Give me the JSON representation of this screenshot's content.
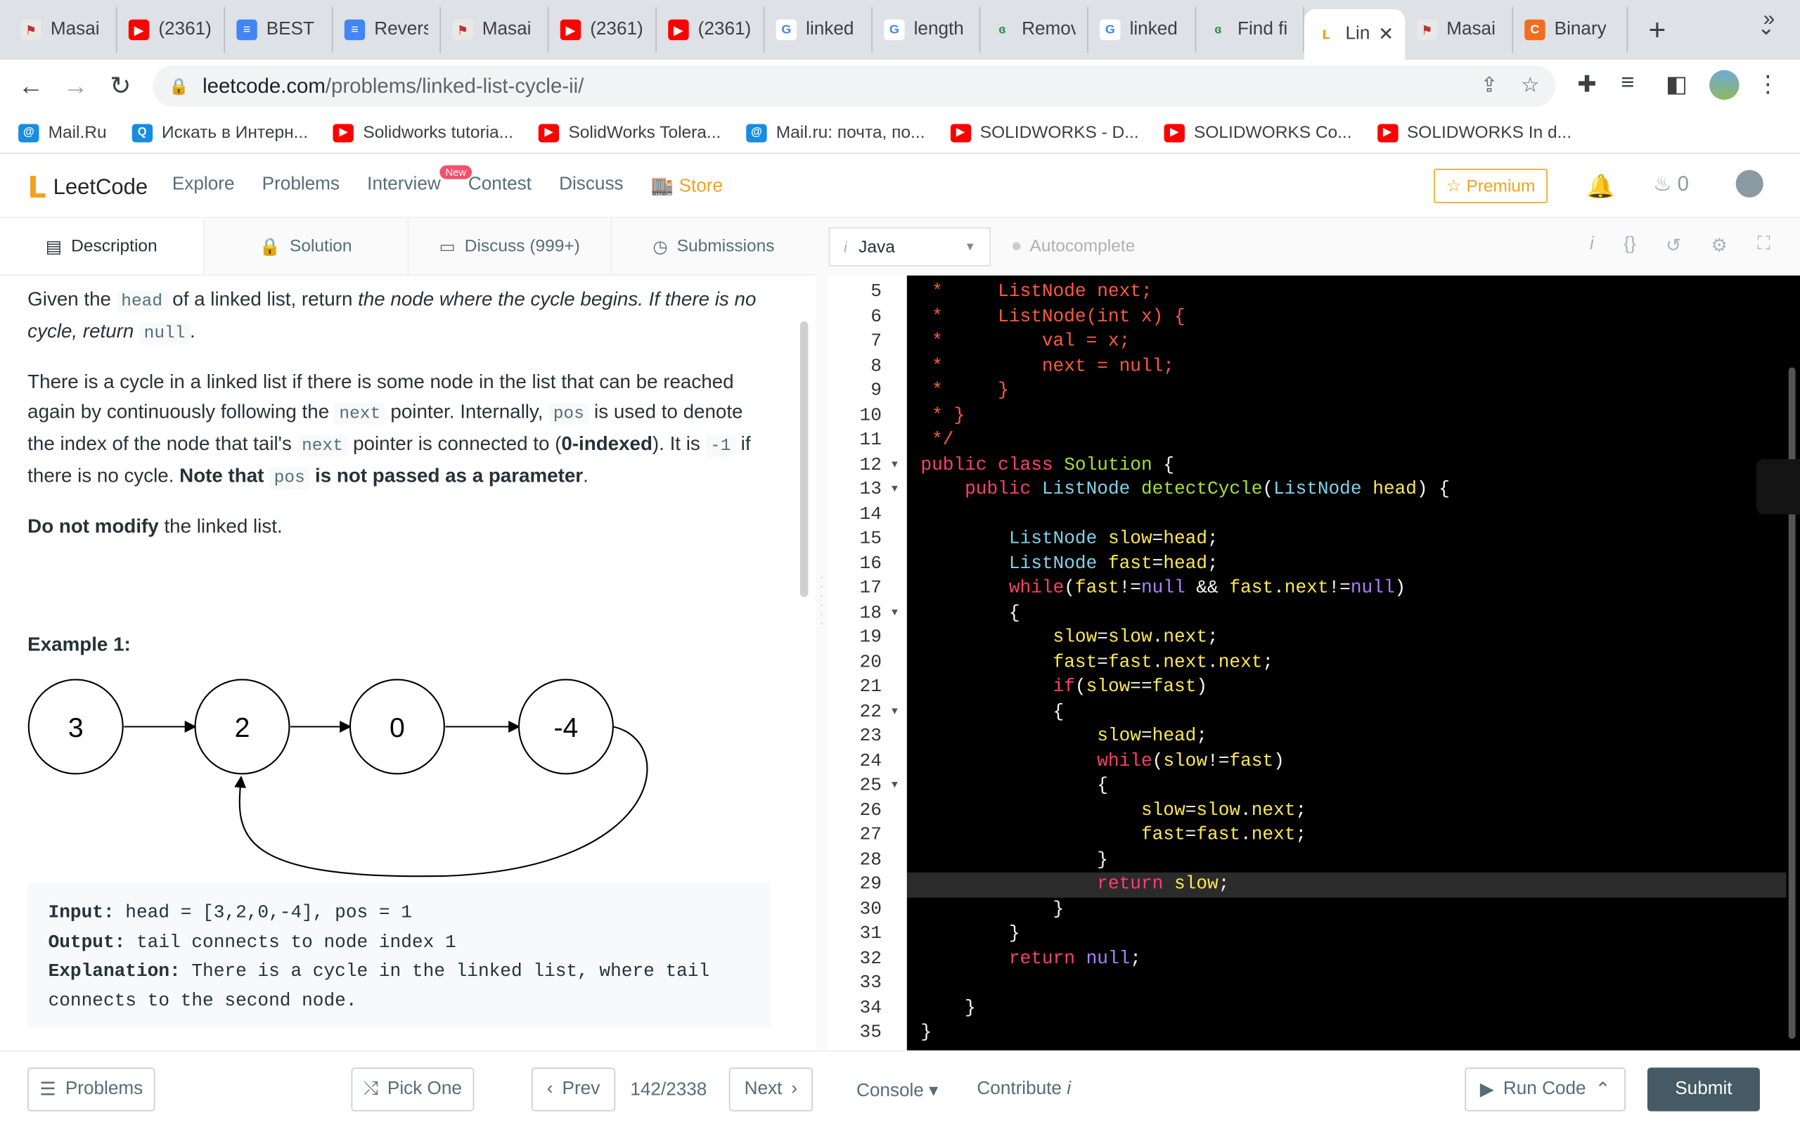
{
  "browser": {
    "tabs": [
      {
        "title": "Masai",
        "icon": "masai-icon",
        "color": "#e8e8e8"
      },
      {
        "title": "(2361)",
        "icon": "youtube-icon",
        "color": "#ff0000"
      },
      {
        "title": "BEST I",
        "icon": "docs-icon",
        "color": "#4285f4"
      },
      {
        "title": "Revers",
        "icon": "docs-icon",
        "color": "#4285f4"
      },
      {
        "title": "Masai",
        "icon": "masai-icon",
        "color": "#e8e8e8"
      },
      {
        "title": "(2361)",
        "icon": "youtube-icon",
        "color": "#ff0000"
      },
      {
        "title": "(2361)",
        "icon": "youtube-icon",
        "color": "#ff0000"
      },
      {
        "title": "linked",
        "icon": "google-icon",
        "color": "#ffffff"
      },
      {
        "title": "length",
        "icon": "google-icon",
        "color": "#ffffff"
      },
      {
        "title": "Remov",
        "icon": "gfg-icon",
        "color": "#2f8d46"
      },
      {
        "title": "linked",
        "icon": "google-icon",
        "color": "#ffffff"
      },
      {
        "title": "Find fi",
        "icon": "gfg-icon",
        "color": "#2f8d46"
      },
      {
        "title": "Lin",
        "icon": "leetcode-icon",
        "color": "#ffffff",
        "active": true
      },
      {
        "title": "Masai",
        "icon": "masai-icon",
        "color": "#e8e8e8"
      },
      {
        "title": "Binary",
        "icon": "codingninjas-icon",
        "color": "#f26d21"
      }
    ],
    "url_host": "leetcode.com",
    "url_path": "/problems/linked-list-cycle-ii/",
    "bookmarks": [
      {
        "label": "Mail.Ru",
        "icon": "mailru-icon",
        "color": "#168de2"
      },
      {
        "label": "Искать в Интерн...",
        "icon": "search-icon",
        "color": "#168de2"
      },
      {
        "label": "Solidworks tutoria...",
        "icon": "youtube-icon",
        "color": "#ff0000"
      },
      {
        "label": "SolidWorks Tolera...",
        "icon": "youtube-icon",
        "color": "#ff0000"
      },
      {
        "label": "Mail.ru: почта, по...",
        "icon": "mailru-icon",
        "color": "#168de2"
      },
      {
        "label": "SOLIDWORKS - D...",
        "icon": "youtube-icon",
        "color": "#ff0000"
      },
      {
        "label": "SOLIDWORKS Co...",
        "icon": "youtube-icon",
        "color": "#ff0000"
      },
      {
        "label": "SOLIDWORKS In d...",
        "icon": "youtube-icon",
        "color": "#ff0000"
      }
    ],
    "bookmarks_more": "»"
  },
  "nav": {
    "brand": "LeetCode",
    "links": [
      "Explore",
      "Problems",
      "Interview",
      "Contest",
      "Discuss"
    ],
    "store": "Store",
    "new_badge": "New",
    "premium": "Premium",
    "streak_count": "0"
  },
  "left_tabs": [
    "Description",
    "Solution",
    "Discuss (999+)",
    "Submissions"
  ],
  "description": {
    "p1_a": "Given the ",
    "p1_code1": "head",
    "p1_b": " of a linked list, return ",
    "p1_em": "the node where the cycle begins. If there is no cycle, return",
    "p1_code2": "null",
    "p1_c": ".",
    "p2_a": "There is a cycle in a linked list if there is some node in the list that can be reached again by continuously following the ",
    "p2_code1": "next",
    "p2_b": " pointer. Internally, ",
    "p2_code2": "pos",
    "p2_c": " is used to denote the index of the node that tail's ",
    "p2_code3": "next",
    "p2_d": " pointer is connected to (",
    "p2_bold1": "0-indexed",
    "p2_e": "). It is ",
    "p2_code4": "-1",
    "p2_f": " if there is no cycle. ",
    "p2_bold2": "Note that ",
    "p2_code5": "pos",
    "p2_bold3": " is not passed as a parameter",
    "p2_g": ".",
    "p3_bold": "Do not modify",
    "p3_rest": " the linked list."
  },
  "example": {
    "title": "Example 1:",
    "nodes": [
      "3",
      "2",
      "0",
      "-4"
    ],
    "input_label": "Input:",
    "input": " head = [3,2,0,-4], pos = 1",
    "output_label": "Output:",
    "output": " tail connects to node index 1",
    "explanation_label": "Explanation:",
    "explanation": " There is a cycle in the linked list, where tail",
    "explanation2": "connects to the second node."
  },
  "editor": {
    "language": "Java",
    "autocomplete": "Autocomplete",
    "lines": [
      {
        "n": "5",
        "fold": false,
        "tokens": [
          [
            "c-cm",
            " *     ListNode next;"
          ]
        ]
      },
      {
        "n": "6",
        "fold": false,
        "tokens": [
          [
            "c-cm",
            " *     ListNode(int x) {"
          ]
        ]
      },
      {
        "n": "7",
        "fold": false,
        "tokens": [
          [
            "c-cm",
            " *         val = x;"
          ]
        ]
      },
      {
        "n": "8",
        "fold": false,
        "tokens": [
          [
            "c-cm",
            " *         next = null;"
          ]
        ]
      },
      {
        "n": "9",
        "fold": false,
        "tokens": [
          [
            "c-cm",
            " *     }"
          ]
        ]
      },
      {
        "n": "10",
        "fold": false,
        "tokens": [
          [
            "c-cm",
            " * }"
          ]
        ]
      },
      {
        "n": "11",
        "fold": false,
        "tokens": [
          [
            "c-cm",
            " */"
          ]
        ]
      },
      {
        "n": "12",
        "fold": true,
        "tokens": [
          [
            "c-kw",
            "public class "
          ],
          [
            "c-fn",
            "Solution"
          ],
          [
            "c-pl",
            " {"
          ]
        ]
      },
      {
        "n": "13",
        "fold": true,
        "tokens": [
          [
            "c-pl",
            "    "
          ],
          [
            "c-kw",
            "public "
          ],
          [
            "c-ty",
            "ListNode "
          ],
          [
            "c-fn",
            "detectCycle"
          ],
          [
            "c-pl",
            "("
          ],
          [
            "c-ty",
            "ListNode "
          ],
          [
            "c-id",
            "head"
          ],
          [
            "c-pl",
            ") {"
          ]
        ]
      },
      {
        "n": "14",
        "fold": false,
        "tokens": [
          [
            "c-pl",
            ""
          ]
        ]
      },
      {
        "n": "15",
        "fold": false,
        "tokens": [
          [
            "c-pl",
            "        "
          ],
          [
            "c-ty",
            "ListNode "
          ],
          [
            "c-id",
            "slow"
          ],
          [
            "c-pl",
            "="
          ],
          [
            "c-id",
            "head"
          ],
          [
            "c-pl",
            ";"
          ]
        ]
      },
      {
        "n": "16",
        "fold": false,
        "tokens": [
          [
            "c-pl",
            "        "
          ],
          [
            "c-ty",
            "ListNode "
          ],
          [
            "c-id",
            "fast"
          ],
          [
            "c-pl",
            "="
          ],
          [
            "c-id",
            "head"
          ],
          [
            "c-pl",
            ";"
          ]
        ]
      },
      {
        "n": "17",
        "fold": false,
        "tokens": [
          [
            "c-pl",
            "        "
          ],
          [
            "c-kw",
            "while"
          ],
          [
            "c-pl",
            "("
          ],
          [
            "c-id",
            "fast"
          ],
          [
            "c-pl",
            "!="
          ],
          [
            "c-nl",
            "null"
          ],
          [
            "c-pl",
            " && "
          ],
          [
            "c-id",
            "fast"
          ],
          [
            "c-pl",
            "."
          ],
          [
            "c-id",
            "next"
          ],
          [
            "c-pl",
            "!="
          ],
          [
            "c-nl",
            "null"
          ],
          [
            "c-pl",
            ")"
          ]
        ]
      },
      {
        "n": "18",
        "fold": true,
        "tokens": [
          [
            "c-pl",
            "        {"
          ]
        ]
      },
      {
        "n": "19",
        "fold": false,
        "tokens": [
          [
            "c-pl",
            "            "
          ],
          [
            "c-id",
            "slow"
          ],
          [
            "c-pl",
            "="
          ],
          [
            "c-id",
            "slow"
          ],
          [
            "c-pl",
            "."
          ],
          [
            "c-id",
            "next"
          ],
          [
            "c-pl",
            ";"
          ]
        ]
      },
      {
        "n": "20",
        "fold": false,
        "tokens": [
          [
            "c-pl",
            "            "
          ],
          [
            "c-id",
            "fast"
          ],
          [
            "c-pl",
            "="
          ],
          [
            "c-id",
            "fast"
          ],
          [
            "c-pl",
            "."
          ],
          [
            "c-id",
            "next"
          ],
          [
            "c-pl",
            "."
          ],
          [
            "c-id",
            "next"
          ],
          [
            "c-pl",
            ";"
          ]
        ]
      },
      {
        "n": "21",
        "fold": false,
        "tokens": [
          [
            "c-pl",
            "            "
          ],
          [
            "c-kw",
            "if"
          ],
          [
            "c-pl",
            "("
          ],
          [
            "c-id",
            "slow"
          ],
          [
            "c-pl",
            "=="
          ],
          [
            "c-id",
            "fast"
          ],
          [
            "c-pl",
            ")"
          ]
        ]
      },
      {
        "n": "22",
        "fold": true,
        "tokens": [
          [
            "c-pl",
            "            {"
          ]
        ]
      },
      {
        "n": "23",
        "fold": false,
        "tokens": [
          [
            "c-pl",
            "                "
          ],
          [
            "c-id",
            "slow"
          ],
          [
            "c-pl",
            "="
          ],
          [
            "c-id",
            "head"
          ],
          [
            "c-pl",
            ";"
          ]
        ]
      },
      {
        "n": "24",
        "fold": false,
        "tokens": [
          [
            "c-pl",
            "                "
          ],
          [
            "c-kw",
            "while"
          ],
          [
            "c-pl",
            "("
          ],
          [
            "c-id",
            "slow"
          ],
          [
            "c-pl",
            "!="
          ],
          [
            "c-id",
            "fast"
          ],
          [
            "c-pl",
            ")"
          ]
        ]
      },
      {
        "n": "25",
        "fold": true,
        "tokens": [
          [
            "c-pl",
            "                {"
          ]
        ]
      },
      {
        "n": "26",
        "fold": false,
        "tokens": [
          [
            "c-pl",
            "                    "
          ],
          [
            "c-id",
            "slow"
          ],
          [
            "c-pl",
            "="
          ],
          [
            "c-id",
            "slow"
          ],
          [
            "c-pl",
            "."
          ],
          [
            "c-id",
            "next"
          ],
          [
            "c-pl",
            ";"
          ]
        ]
      },
      {
        "n": "27",
        "fold": false,
        "tokens": [
          [
            "c-pl",
            "                    "
          ],
          [
            "c-id",
            "fast"
          ],
          [
            "c-pl",
            "="
          ],
          [
            "c-id",
            "fast"
          ],
          [
            "c-pl",
            "."
          ],
          [
            "c-id",
            "next"
          ],
          [
            "c-pl",
            ";"
          ]
        ]
      },
      {
        "n": "28",
        "fold": false,
        "tokens": [
          [
            "c-pl",
            "                }"
          ]
        ]
      },
      {
        "n": "29",
        "fold": false,
        "highlight": true,
        "tokens": [
          [
            "c-pl",
            "                "
          ],
          [
            "c-kw",
            "return "
          ],
          [
            "c-id",
            "slow"
          ],
          [
            "c-pl",
            ";"
          ]
        ]
      },
      {
        "n": "30",
        "fold": false,
        "tokens": [
          [
            "c-pl",
            "            }"
          ]
        ]
      },
      {
        "n": "31",
        "fold": false,
        "tokens": [
          [
            "c-pl",
            "        }"
          ]
        ]
      },
      {
        "n": "32",
        "fold": false,
        "tokens": [
          [
            "c-pl",
            "        "
          ],
          [
            "c-kw",
            "return "
          ],
          [
            "c-nl",
            "null"
          ],
          [
            "c-pl",
            ";"
          ]
        ]
      },
      {
        "n": "33",
        "fold": false,
        "tokens": [
          [
            "c-pl",
            ""
          ]
        ]
      },
      {
        "n": "34",
        "fold": false,
        "tokens": [
          [
            "c-pl",
            "    }"
          ]
        ]
      },
      {
        "n": "35",
        "fold": false,
        "tokens": [
          [
            "c-pl",
            "}"
          ]
        ]
      }
    ]
  },
  "bottom": {
    "problems": "Problems",
    "pick_one": "Pick One",
    "prev": "Prev",
    "counter": "142/2338",
    "next": "Next",
    "console": "Console",
    "contribute": "Contribute",
    "run_code": "Run Code",
    "submit": "Submit"
  }
}
